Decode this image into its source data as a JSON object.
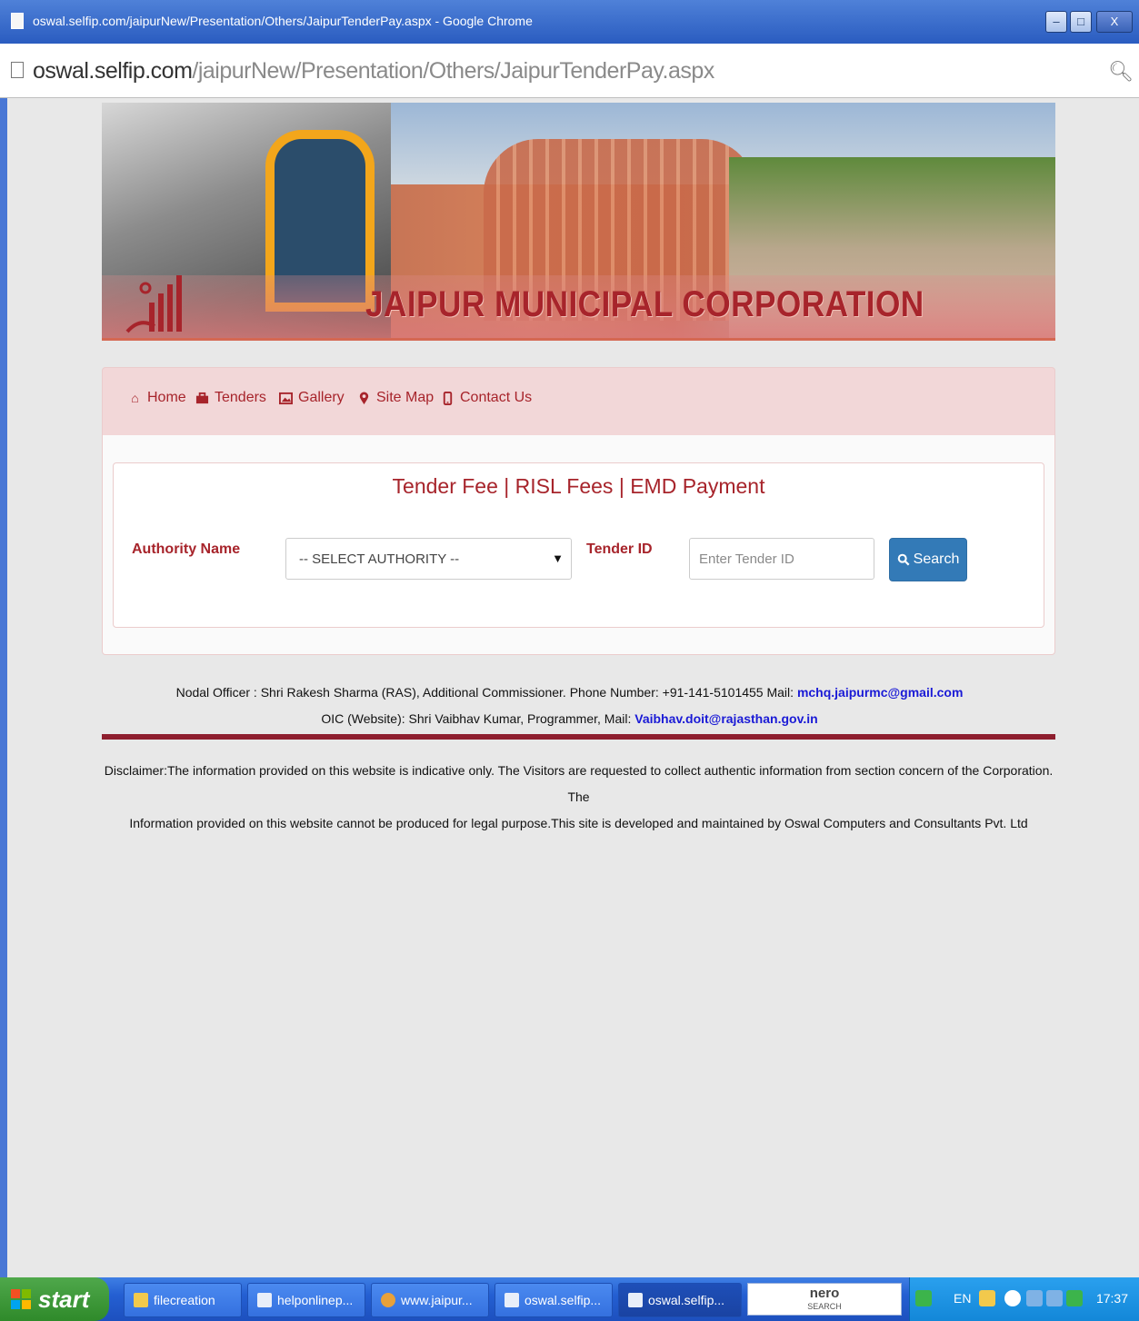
{
  "window": {
    "title": "oswal.selfip.com/jaipurNew/Presentation/Others/JaipurTenderPay.aspx - Google Chrome",
    "minimize_label": "–",
    "maximize_label": "□",
    "close_label": "X"
  },
  "address_bar": {
    "host": "oswal.selfip.com",
    "path": "/jaipurNew/Presentation/Others/JaipurTenderPay.aspx"
  },
  "banner": {
    "title": "JAIPUR MUNICIPAL CORPORATION"
  },
  "nav": {
    "items": [
      {
        "label": "Home",
        "icon": "home-icon"
      },
      {
        "label": "Tenders",
        "icon": "briefcase-icon"
      },
      {
        "label": "Gallery",
        "icon": "picture-icon"
      },
      {
        "label": "Site Map",
        "icon": "map-marker-icon"
      },
      {
        "label": "Contact Us",
        "icon": "phone-icon"
      }
    ]
  },
  "form": {
    "heading": "Tender Fee | RISL Fees | EMD Payment",
    "authority_label": "Authority Name",
    "authority_selected": "-- SELECT AUTHORITY --",
    "tender_label": "Tender ID",
    "tender_placeholder": "Enter Tender ID",
    "tender_value": "",
    "search_label": "Search"
  },
  "footer": {
    "nodal_text": "Nodal Officer : Shri Rakesh Sharma (RAS), Additional Commissioner. Phone Number: +91-141-5101455 Mail: ",
    "nodal_email": "mchq.jaipurmc@gmail.com",
    "oic_text": "OIC (Website): Shri Vaibhav Kumar, Programmer, Mail: ",
    "oic_email": "Vaibhav.doit@rajasthan.gov.in",
    "disclaimer_line1": "Disclaimer:The information provided on this website is indicative only. The Visitors are requested to collect authentic information from section concern of the Corporation. The",
    "disclaimer_line2": "Information provided on this website cannot be produced for legal purpose.This site is developed and maintained by Oswal Computers and Consultants Pvt. Ltd"
  },
  "taskbar": {
    "start_label": "start",
    "items": [
      {
        "label": "filecreation",
        "color": "#f2c94c"
      },
      {
        "label": "helponlinep...",
        "color": "#e8eef9"
      },
      {
        "label": "www.jaipur...",
        "color": "#e8a13a"
      },
      {
        "label": "oswal.selfip...",
        "color": "#e8eef9"
      },
      {
        "label": "oswal.selfip...",
        "color": "#e8eef9"
      }
    ],
    "nero_line1": "nero",
    "nero_line2": "SEARCH",
    "language": "EN",
    "clock": "17:37"
  },
  "colors": {
    "brand_maroon": "#a7242b",
    "nav_background": "#f2d7d8",
    "button_blue": "#337ab7",
    "link_blue": "#1a1ad6"
  }
}
